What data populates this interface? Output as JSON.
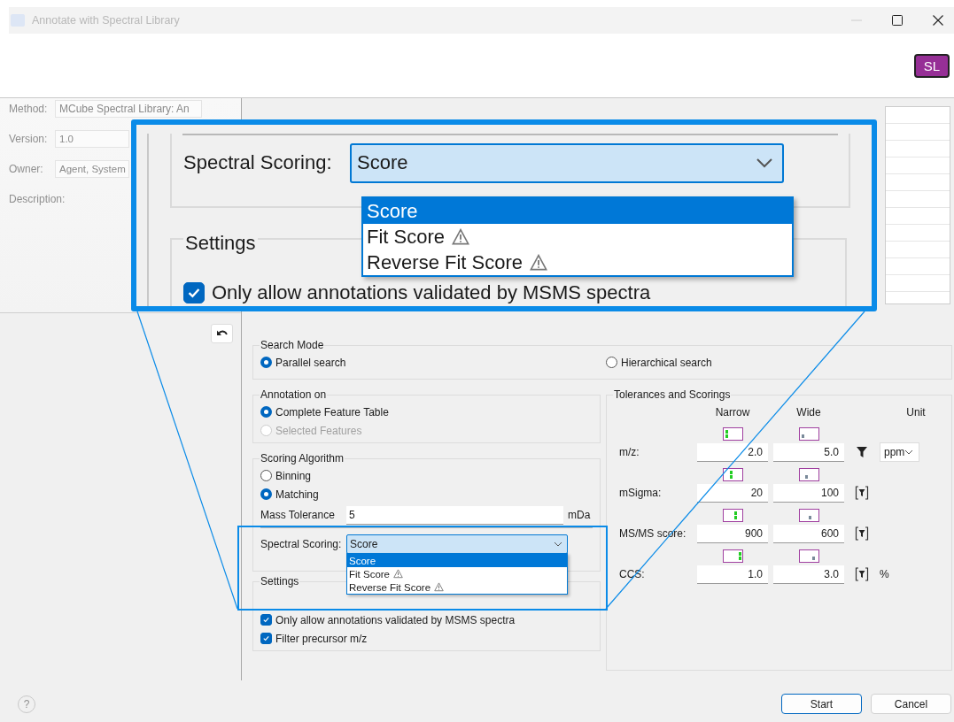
{
  "window": {
    "title": "Annotate with Spectral Library",
    "badge": "SL"
  },
  "method_panel": {
    "fields": [
      {
        "label": "Method:",
        "value": "MCube Spectral Library: An",
        "kind": "dropdown"
      },
      {
        "label": "Version:",
        "value": "1.0",
        "kind": "text"
      },
      {
        "label": "Owner:",
        "value": "Agent, System",
        "kind": "text"
      },
      {
        "label": "Description:",
        "kind": "label"
      }
    ]
  },
  "magnified_view": {
    "label": "Spectral Scoring:",
    "value": "Score",
    "expanded": true,
    "options": [
      {
        "label": "Score",
        "warning": false,
        "selected": true
      },
      {
        "label": "Fit Score",
        "warning": true,
        "selected": false
      },
      {
        "label": "Reverse Fit Score",
        "warning": true,
        "selected": false
      }
    ],
    "settings_title": "Settings",
    "checkbox": {
      "label": "Only allow annotations validated by MSMS spectra",
      "checked": true
    }
  },
  "search_mode": {
    "title": "Search Mode",
    "options": [
      {
        "label": "Parallel search",
        "selected": true,
        "disabled": false
      },
      {
        "label": "Hierarchical search",
        "selected": false,
        "disabled": false
      }
    ]
  },
  "annotation_on": {
    "title": "Annotation on",
    "options": [
      {
        "label": "Complete Feature Table",
        "selected": true,
        "disabled": false
      },
      {
        "label": "Selected Features",
        "selected": false,
        "disabled": true
      }
    ]
  },
  "scoring_algorithm": {
    "title": "Scoring Algorithm",
    "options": [
      {
        "label": "Binning",
        "selected": false,
        "disabled": false
      },
      {
        "label": "Matching",
        "selected": true,
        "disabled": false
      }
    ],
    "mass_tolerance": {
      "label": "Mass Tolerance",
      "value": "5",
      "unit": "mDa"
    },
    "spectral_scoring": {
      "label": "Spectral Scoring:",
      "value": "Score",
      "expanded": true,
      "options": [
        {
          "label": "Score",
          "warning": false,
          "selected": true
        },
        {
          "label": "Fit Score",
          "warning": true,
          "selected": false
        },
        {
          "label": "Reverse Fit Score",
          "warning": true,
          "selected": false
        }
      ]
    }
  },
  "settings": {
    "title": "Settings",
    "checkboxes": [
      {
        "label": "Only allow annotations validated by MSMS spectra",
        "checked": true
      },
      {
        "label": "Filter precursor m/z",
        "checked": true
      }
    ]
  },
  "tolerances": {
    "title": "Tolerances and Scorings",
    "columns": [
      "Narrow",
      "Wide",
      "Unit"
    ],
    "rows": [
      {
        "label": "m/z:",
        "narrow": "2.0",
        "wide": "5.0",
        "kind": "solid_filter",
        "unit": {
          "kind": "dropdown",
          "value": "ppm"
        }
      },
      {
        "label": "mSigma:",
        "narrow": "20",
        "wide": "100",
        "kind": "bracketed_filter"
      },
      {
        "label": "MS/MS score:",
        "narrow": "900",
        "wide": "600",
        "kind": "bracketed_filter"
      },
      {
        "label": "CCS:",
        "narrow": "1.0",
        "wide": "3.0",
        "kind": "bracketed_filter",
        "unit": {
          "kind": "text",
          "value": "%"
        }
      }
    ]
  },
  "help": "?",
  "buttons": [
    {
      "label": "Start",
      "default": true
    },
    {
      "label": "Cancel",
      "default": false
    }
  ]
}
